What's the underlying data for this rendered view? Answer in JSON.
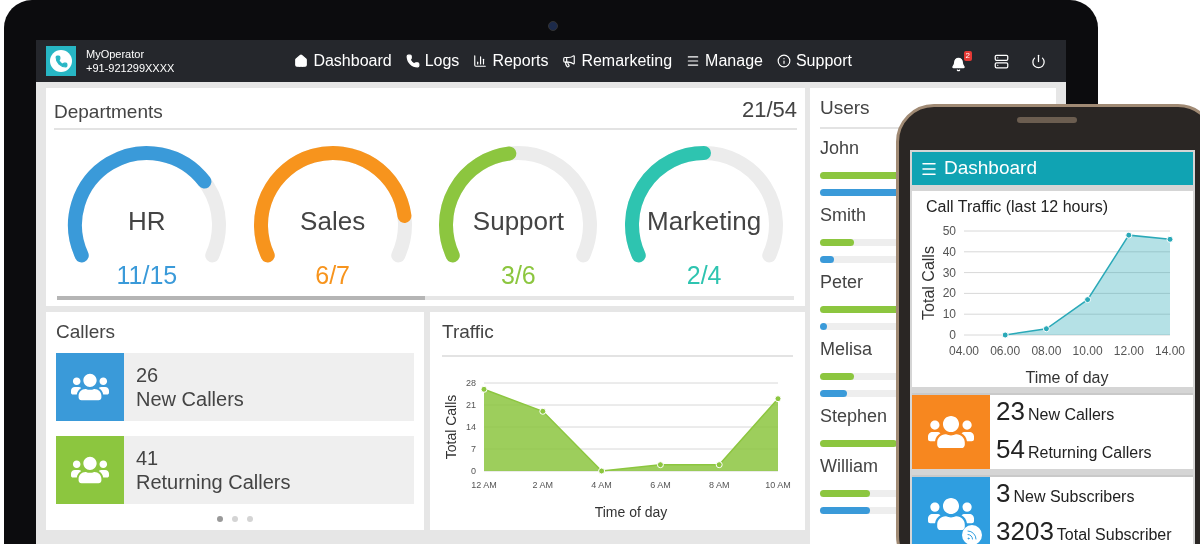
{
  "brand": {
    "name": "MyOperator",
    "phone": "+91-921299XXXX"
  },
  "nav": [
    {
      "kind": "home",
      "label": "Dashboard"
    },
    {
      "kind": "phone",
      "label": "Logs"
    },
    {
      "kind": "chart",
      "label": "Reports"
    },
    {
      "kind": "megaphone",
      "label": "Remarketing"
    },
    {
      "kind": "menu",
      "label": "Manage"
    },
    {
      "kind": "info",
      "label": "Support"
    }
  ],
  "notifications": {
    "count": "2"
  },
  "departments": {
    "title": "Departments",
    "count": "21/54",
    "gauges": [
      {
        "name": "HR",
        "value": "11/15",
        "color": "#3a9ad9"
      },
      {
        "name": "Sales",
        "value": "6/7",
        "color": "#f7941d"
      },
      {
        "name": "Support",
        "value": "3/6",
        "color": "#8cc63f"
      },
      {
        "name": "Marketing",
        "value": "2/4",
        "color": "#2ec4b0"
      }
    ]
  },
  "callers": {
    "title": "Callers",
    "cards": [
      {
        "count": "26",
        "label": "New Callers",
        "color": "#3a9ad9"
      },
      {
        "count": "41",
        "label": "Returning Callers",
        "color": "#8cc63f"
      }
    ],
    "pages": [
      {
        "selected": true
      },
      {
        "selected": false
      },
      {
        "selected": false
      }
    ]
  },
  "traffic": {
    "title": "Traffic",
    "chart_data": {
      "type": "area",
      "xlabel": "Time of day",
      "ylabel": "Total Calls",
      "categories": [
        "12 AM",
        "2 AM",
        "4 AM",
        "6 AM",
        "8 AM",
        "10 AM"
      ],
      "series": [
        {
          "color": "#8cc63f",
          "values": [
            26,
            19,
            0,
            2,
            2,
            23
          ]
        }
      ],
      "ylim": [
        0,
        28
      ],
      "yticks": [
        0,
        7,
        14,
        21,
        28
      ],
      "grid": true
    }
  },
  "users": {
    "title": "Users",
    "rows": [
      {
        "name": "John",
        "bars": [
          {
            "color": "#8cc63f",
            "level": 1
          },
          {
            "color": "#3a9ad9",
            "level": 1
          }
        ]
      },
      {
        "name": "Smith",
        "bars": [
          {
            "color": "#8cc63f",
            "level": 0.38
          },
          {
            "color": "#3a9ad9",
            "level": 0.15
          }
        ]
      },
      {
        "name": "Peter",
        "bars": [
          {
            "color": "#8cc63f",
            "level": 1
          },
          {
            "color": "#3a9ad9",
            "level": 0.08
          }
        ]
      },
      {
        "name": "Melisa",
        "bars": [
          {
            "color": "#8cc63f",
            "level": 0.38
          },
          {
            "color": "#3a9ad9",
            "level": 0.3
          }
        ]
      },
      {
        "name": "Stephen",
        "bars": [
          {
            "color": "#8cc63f",
            "level": 0.85
          }
        ]
      },
      {
        "name": "William",
        "bars": [
          {
            "color": "#8cc63f",
            "level": 0.55
          },
          {
            "color": "#3a9ad9",
            "level": 0.55
          }
        ]
      }
    ]
  },
  "phone": {
    "title": "Dashboard",
    "chart_data": {
      "type": "area",
      "title": "Call Traffic (last 12 hours)",
      "xlabel": "Time of day",
      "ylabel": "Total Calls",
      "categories": [
        "04.00",
        "06.00",
        "08.00",
        "10.00",
        "12.00",
        "14.00"
      ],
      "series": [
        {
          "color": "#2aa9b8",
          "values": [
            null,
            0,
            3,
            17,
            48,
            46
          ]
        }
      ],
      "ylim": [
        0,
        50
      ],
      "yticks": [
        0,
        10,
        20,
        30,
        40,
        50
      ],
      "grid": true
    },
    "cards": [
      {
        "kind": "callers",
        "color": "#f7871f",
        "lines": [
          {
            "count": "23",
            "label": "New Callers"
          },
          {
            "count": "54",
            "label": "Returning Callers"
          }
        ]
      },
      {
        "kind": "subscribers",
        "color": "#2f9ee0",
        "lines": [
          {
            "count": "3",
            "label": "New Subscribers"
          },
          {
            "count": "3203",
            "label": "Total Subscriber"
          }
        ]
      }
    ]
  }
}
